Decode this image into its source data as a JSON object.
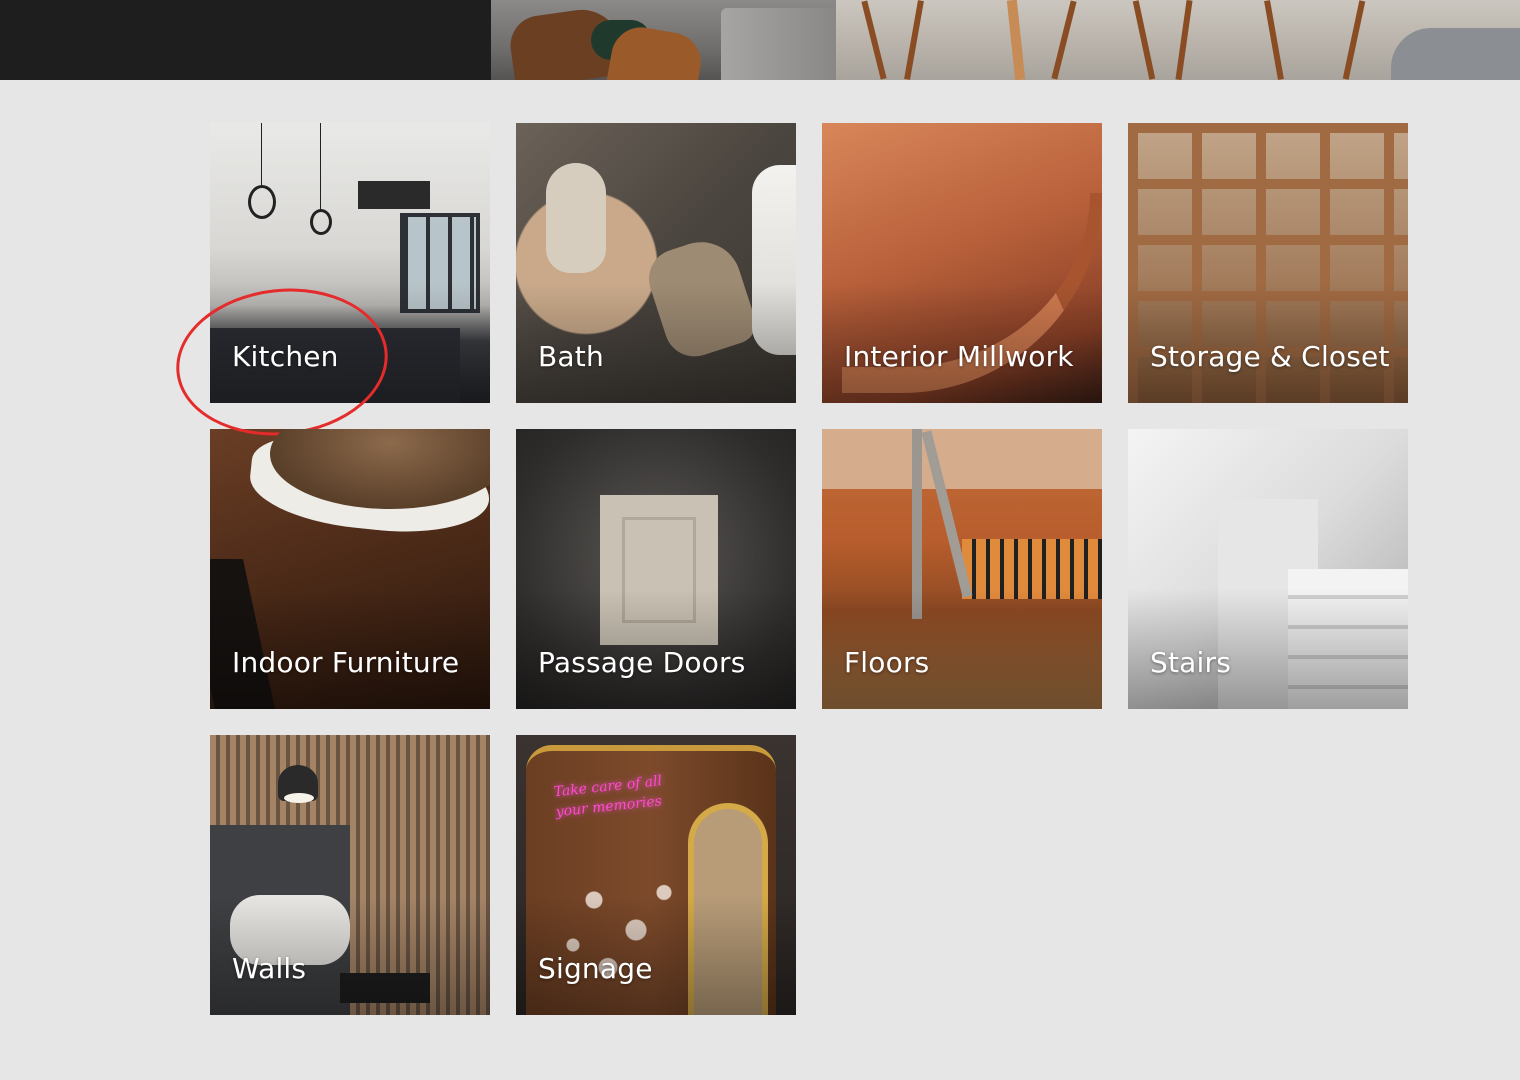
{
  "colors": {
    "page_background": "#e6e6e6",
    "banner_dark": "#1e1e1e",
    "annotation_red": "#e52b2b",
    "label_text": "#ffffff"
  },
  "categories": [
    {
      "label": "Kitchen"
    },
    {
      "label": "Bath"
    },
    {
      "label": "Interior Millwork"
    },
    {
      "label": "Storage & Closet"
    },
    {
      "label": "Indoor Furniture"
    },
    {
      "label": "Passage Doors"
    },
    {
      "label": "Floors"
    },
    {
      "label": "Stairs"
    },
    {
      "label": "Walls"
    },
    {
      "label": "Signage"
    }
  ],
  "signage_neon_text": "Take care of all your memories"
}
